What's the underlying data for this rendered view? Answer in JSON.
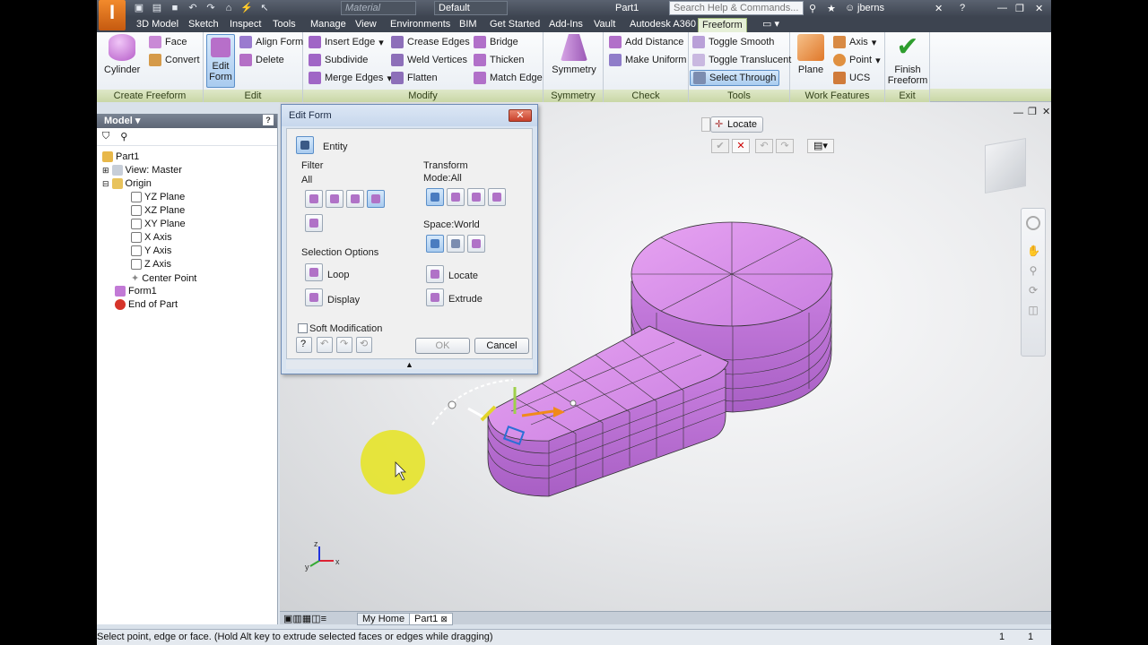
{
  "titlebar": {
    "logo": "I",
    "material_value": "Material",
    "appearance_value": "Default",
    "doc_title": "Part1",
    "search_placeholder": "Search Help & Commands...",
    "user": "jberns"
  },
  "tabs": [
    "3D Model",
    "Sketch",
    "Inspect",
    "Tools",
    "Manage",
    "View",
    "Environments",
    "BIM",
    "Get Started",
    "Add-Ins",
    "Vault",
    "Autodesk A360",
    "Freeform"
  ],
  "ribbon": {
    "create_freeform": {
      "title": "Create Freeform",
      "cylinder": "Cylinder",
      "face": "Face",
      "convert": "Convert"
    },
    "edit": {
      "title": "Edit",
      "edit_form_line1": "Edit",
      "edit_form_line2": "Form",
      "align_form": "Align Form",
      "delete": "Delete"
    },
    "modify": {
      "title": "Modify",
      "insert_edge": "Insert Edge",
      "subdivide": "Subdivide",
      "merge_edges": "Merge Edges",
      "crease_edges": "Crease Edges",
      "weld_vertices": "Weld Vertices",
      "flatten": "Flatten",
      "bridge": "Bridge",
      "thicken": "Thicken",
      "match_edge": "Match Edge"
    },
    "symmetry": {
      "title": "Symmetry",
      "label": "Symmetry"
    },
    "check": {
      "title": "Check",
      "add_distance": "Add Distance",
      "make_uniform": "Make Uniform"
    },
    "tools": {
      "title": "Tools",
      "toggle_smooth": "Toggle Smooth",
      "toggle_translucent": "Toggle Translucent",
      "select_through": "Select Through"
    },
    "work_features": {
      "title": "Work Features",
      "plane": "Plane",
      "axis": "Axis",
      "point": "Point",
      "ucs": "UCS"
    },
    "exit": {
      "title": "Exit",
      "finish_line1": "Finish",
      "finish_line2": "Freeform"
    }
  },
  "model_browser": {
    "header": "Model",
    "items": [
      "Part1",
      "View: Master",
      "Origin",
      "YZ Plane",
      "XZ Plane",
      "XY Plane",
      "X Axis",
      "Y Axis",
      "Z Axis",
      "Center Point",
      "Form1",
      "End of Part"
    ]
  },
  "dialog": {
    "title": "Edit Form",
    "entity": "Entity",
    "filter": "Filter",
    "filter_value": "All",
    "transform": "Transform",
    "mode": "Mode:All",
    "space": "Space:World",
    "selection_options": "Selection Options",
    "loop": "Loop",
    "display": "Display",
    "locate": "Locate",
    "extrude": "Extrude",
    "soft_modification": "Soft Modification",
    "ok": "OK",
    "cancel": "Cancel"
  },
  "viewport": {
    "locate_label": "Locate"
  },
  "document_tabs": {
    "home": "My Home",
    "part": "Part1"
  },
  "status": {
    "message": "Select point, edge or face. (Hold Alt key to extrude selected faces or edges while dragging)",
    "count1": "1",
    "count2": "1"
  },
  "colors": {
    "form_color": "#d98ee8",
    "ribbon_panel_title": "#c9d7a6",
    "cursor_highlight": "#e6e41e"
  }
}
